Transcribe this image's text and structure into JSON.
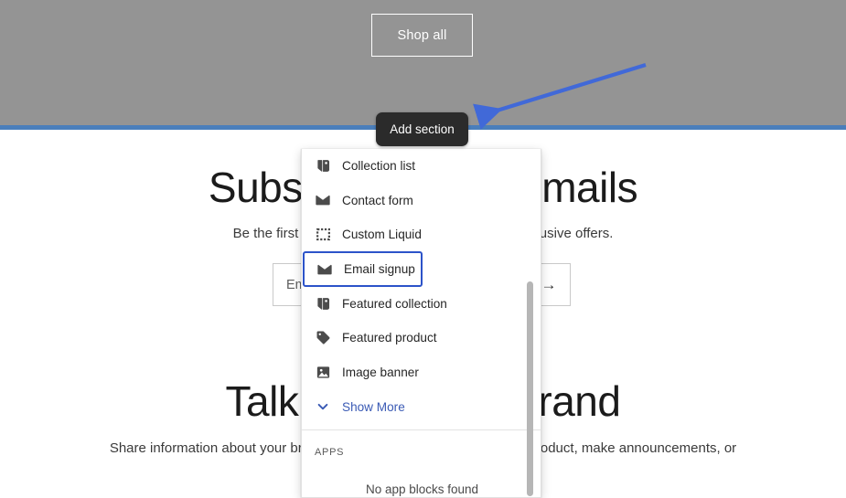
{
  "storefront": {
    "shop_all_label": "Shop all",
    "heading_1": "Subscribe to our emails",
    "subtext_1": "Be the first to know about new collections and exclusive offers.",
    "email_placeholder": "Email",
    "email_submit_icon": "arrow-right-icon",
    "heading_2": "Talk about your brand",
    "subtext_2": "Share information about your brand with your customers. Describe a product, make announcements, or"
  },
  "editor": {
    "add_section_label": "Add section",
    "annotation": {
      "type": "arrow",
      "color": "#4169d8"
    }
  },
  "panel": {
    "sections": [
      {
        "label": "Collection list",
        "icon": "price-tag-icon",
        "selected": false
      },
      {
        "label": "Contact form",
        "icon": "envelope-icon",
        "selected": false
      },
      {
        "label": "Custom Liquid",
        "icon": "dashed-square-icon",
        "selected": false
      },
      {
        "label": "Email signup",
        "icon": "envelope-icon",
        "selected": true
      },
      {
        "label": "Featured collection",
        "icon": "price-tag-icon",
        "selected": false
      },
      {
        "label": "Featured product",
        "icon": "tag-solid-icon",
        "selected": false
      },
      {
        "label": "Image banner",
        "icon": "image-icon",
        "selected": false
      }
    ],
    "show_more_label": "Show More",
    "show_more_icon": "chevron-down-icon",
    "apps_header": "APPS",
    "apps_empty_text": "No app blocks found",
    "selected_color": "#2c53c9",
    "link_color": "#3b5bb5"
  },
  "colors": {
    "banner_gray": "#949494",
    "rule_blue": "#4a7ebb",
    "pill_dark": "#2b2b2b"
  }
}
